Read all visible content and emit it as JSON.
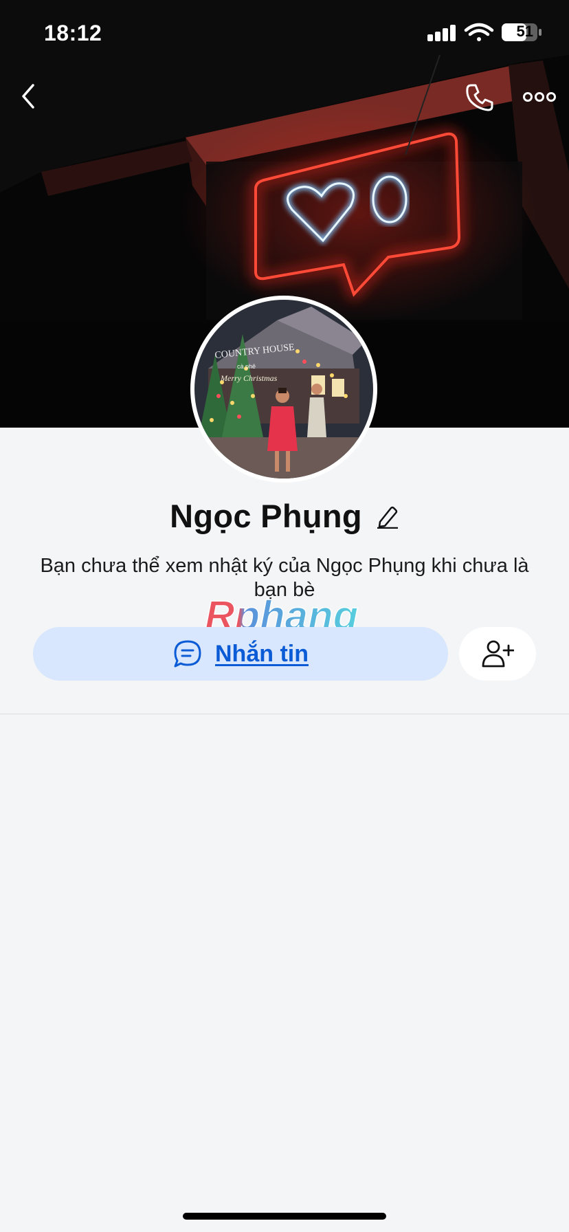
{
  "status_bar": {
    "time": "18:12",
    "battery": "51",
    "icons": [
      "cellular-signal-icon",
      "wifi-icon",
      "battery-icon"
    ]
  },
  "nav": {
    "icons": [
      "back-arrow-icon",
      "phone-icon",
      "more-options-icon"
    ]
  },
  "profile": {
    "name": "Ngọc Phụng",
    "notice": "Bạn chưa thể xem nhật ký của Ngọc Phụng khi chưa là bạn bè",
    "avatar_text": {
      "line1": "COUNTRY HOUSE",
      "line2": "cà phê",
      "line3": "Merry Christmas"
    }
  },
  "actions": {
    "message_label": "Nhắn tin",
    "message_icon": "chat-bubble-icon",
    "add_friend_icon": "add-friend-icon"
  },
  "watermark": {
    "text": "Rphang"
  },
  "colors": {
    "accent": "#0a5bd5",
    "message_button_bg": "#d8e7fd",
    "page_bg": "#f4f5f7",
    "neon_red": "#ff3b2f",
    "neon_blue": "#bfe6ff"
  }
}
